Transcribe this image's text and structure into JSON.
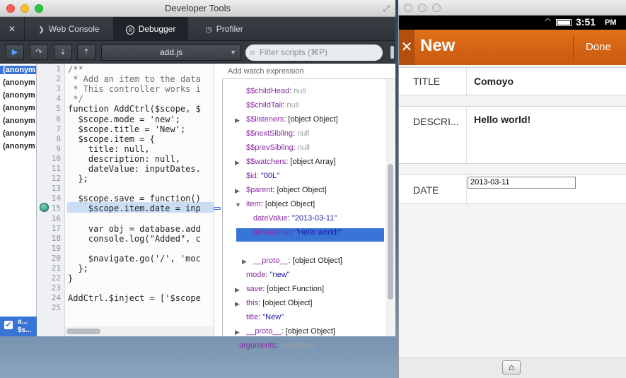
{
  "devtools": {
    "title": "Developer Tools",
    "tabs": [
      {
        "label": "Web Console"
      },
      {
        "label": "Debugger"
      },
      {
        "label": "Profiler"
      }
    ],
    "close_glyph": "✕",
    "toolbar": {
      "file": "add.js",
      "filter_placeholder": "Filter scripts (⌘P)"
    },
    "sources": [
      "(anonym",
      "(anonym",
      "(anonym",
      "(anonym",
      "(anonym",
      "(anonym",
      "(anonym"
    ],
    "bottom_item": {
      "line1": "a...",
      "line2": "$s..."
    },
    "line_numbers": [
      "1",
      "2",
      "3",
      "4",
      "5",
      "6",
      "7",
      "8",
      "9",
      "10",
      "11",
      "12",
      "13",
      "14",
      "15",
      "16",
      "17",
      "18",
      "19",
      "20",
      "21",
      "22",
      "23",
      "24",
      "25"
    ],
    "code_lines": [
      "/**",
      " * Add an item to the data",
      " * This controller works i",
      " */",
      "function AddCtrl($scope, $",
      "  $scope.mode = 'new';",
      "  $scope.title = 'New';",
      "  $scope.item = {",
      "    title: null,",
      "    description: null,",
      "    dateValue: inputDates.",
      "  };",
      "",
      "  $scope.save = function()",
      "    $scope.item.date = inp",
      "",
      "    var obj = database.add",
      "    console.log(\"Added\", c",
      "",
      "    $navigate.go('/', 'moc",
      "  };",
      "}",
      "",
      "AddCtrl.$inject = ['$scope",
      ""
    ],
    "watch_placeholder": "Add watch expression",
    "variables": [
      {
        "key": "$$childHead",
        "value": "null",
        "kind": "gray",
        "indent": 0,
        "arrow": ""
      },
      {
        "key": "$$childTail",
        "value": "null",
        "kind": "gray",
        "indent": 0,
        "arrow": ""
      },
      {
        "key": "$$listeners",
        "value": "[object Object]",
        "kind": "obj",
        "indent": 0,
        "arrow": "▶"
      },
      {
        "key": "$$nextSibling",
        "value": "null",
        "kind": "gray",
        "indent": 0,
        "arrow": ""
      },
      {
        "key": "$$prevSibling",
        "value": "null",
        "kind": "gray",
        "indent": 0,
        "arrow": ""
      },
      {
        "key": "$$watchers",
        "value": "[object Array]",
        "kind": "obj",
        "indent": 0,
        "arrow": "▶"
      },
      {
        "key": "$id",
        "value": "\"00L\"",
        "kind": "str",
        "indent": 0,
        "arrow": ""
      },
      {
        "key": "$parent",
        "value": "[object Object]",
        "kind": "obj",
        "indent": 0,
        "arrow": "▶"
      },
      {
        "key": "item",
        "value": "[object Object]",
        "kind": "obj",
        "indent": 0,
        "arrow": "▼"
      },
      {
        "key": "dateValue",
        "value": "\"2013-03-11\"",
        "kind": "str",
        "indent": 1,
        "arrow": ""
      },
      {
        "key": "description",
        "value": "\"Hello world!\"",
        "kind": "str",
        "indent": 1,
        "arrow": ""
      },
      {
        "key": "title",
        "value": "\"Comoyo\"",
        "kind": "str",
        "indent": 1,
        "arrow": "",
        "selected": true
      },
      {
        "key": "__proto__",
        "value": "[object Object]",
        "kind": "obj",
        "indent": 1,
        "arrow": "▶"
      },
      {
        "key": "mode",
        "value": "\"new\"",
        "kind": "str",
        "indent": 0,
        "arrow": ""
      },
      {
        "key": "save",
        "value": "[object Function]",
        "kind": "obj",
        "indent": 0,
        "arrow": "▶"
      },
      {
        "key": "this",
        "value": "[object Object]",
        "kind": "obj",
        "indent": 0,
        "arrow": "▶"
      },
      {
        "key": "title",
        "value": "\"New\"",
        "kind": "str",
        "indent": 0,
        "arrow": ""
      },
      {
        "key": "__proto__",
        "value": "[object Object]",
        "kind": "obj",
        "indent": 0,
        "arrow": "▶"
      },
      {
        "key": "arguments",
        "value": "undefined",
        "kind": "gray",
        "indent": -1,
        "arrow": ""
      }
    ]
  },
  "simulator": {
    "status_time": "3:51",
    "status_pm": "PM",
    "app_title": "New",
    "done_label": "Done",
    "close_glyph": "✕",
    "fields": [
      {
        "label": "TITLE",
        "value": "Comoyo"
      },
      {
        "label": "DESCRI...",
        "value": "Hello world!"
      },
      {
        "label": "DATE",
        "value": "2013-03-11"
      }
    ]
  },
  "colors": {
    "accent_orange": "#d9661a",
    "selection_blue": "#3875d7"
  }
}
